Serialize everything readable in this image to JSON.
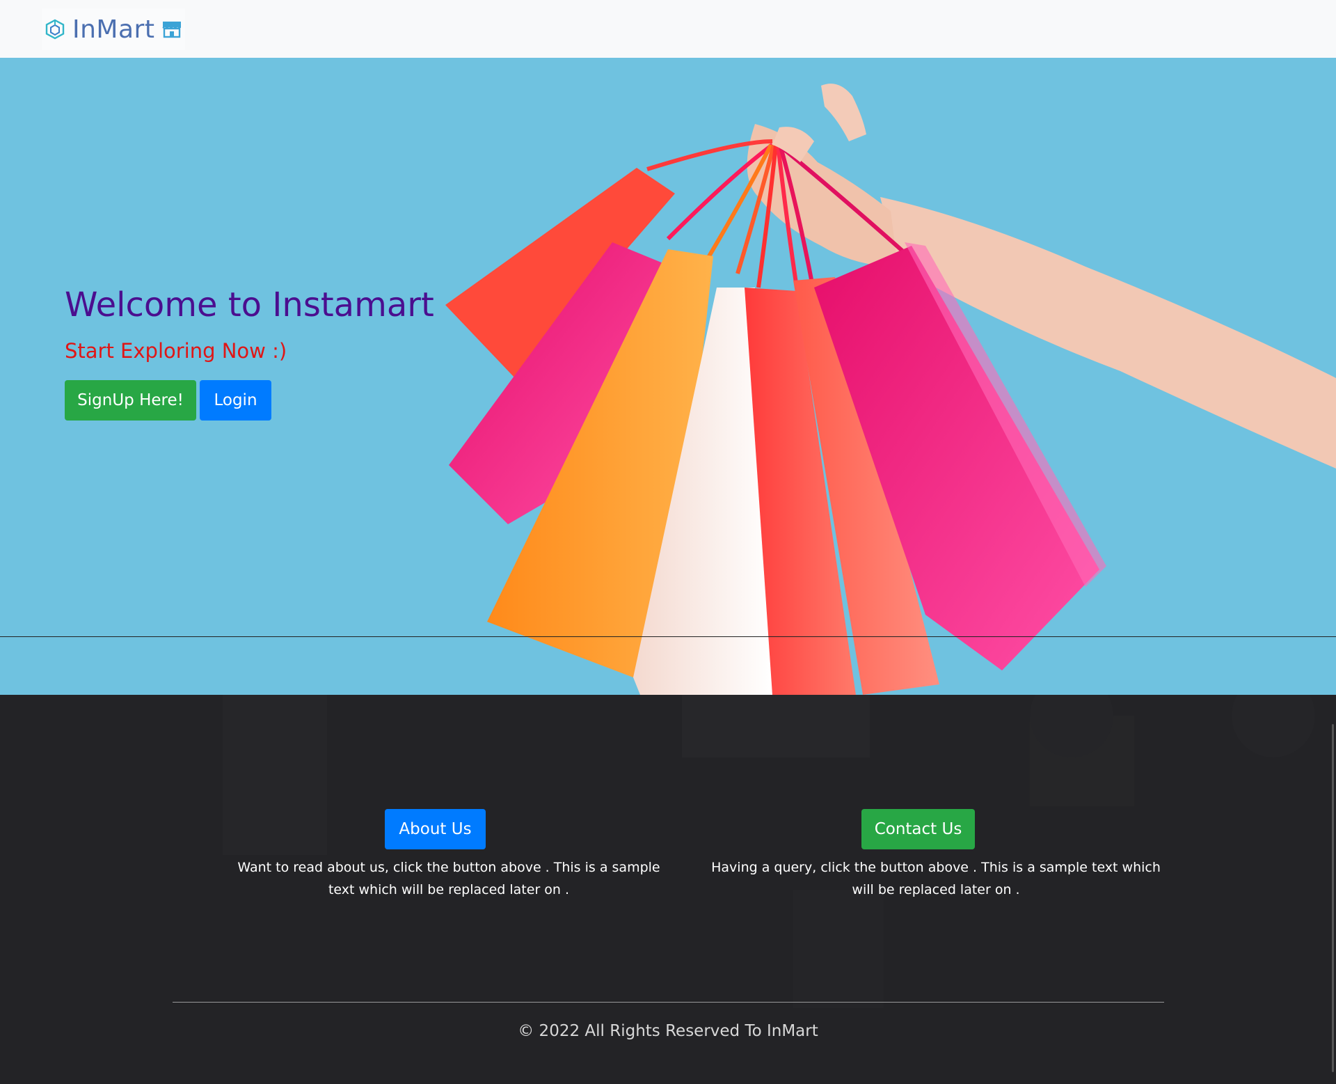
{
  "navbar": {
    "brand_name": "InMart",
    "brand_icon": "cube-icon",
    "store_icon": "store-icon"
  },
  "hero": {
    "title": "Welcome to Instamart",
    "subtitle": "Start Exploring Now :)",
    "signup_label": "SignUp Here!",
    "login_label": "Login",
    "background_color": "#6fc2e0"
  },
  "footer": {
    "about_label": "About Us",
    "about_text": "Want to read about us, click the button above . This is a sample text which will be replaced later on .",
    "contact_label": "Contact Us",
    "contact_text": "Having a query, click the button above . This is a sample text which will be replaced later on .",
    "copyright": "© 2022 All Rights Reserved To InMart"
  },
  "colors": {
    "primary": "#007bff",
    "success": "#28a745",
    "title": "#4b0e8f",
    "subtitle": "#e01616",
    "footer_bg": "#232326"
  }
}
